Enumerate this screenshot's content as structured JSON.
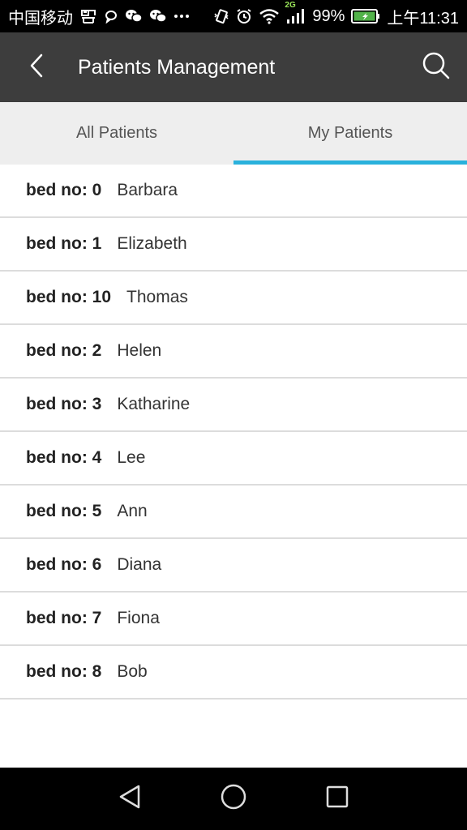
{
  "status_bar": {
    "carrier": "中国移动",
    "network_badge": "2G",
    "battery_percent": "99%",
    "time": "上午11:31",
    "left_icons": [
      "sim-icon",
      "chat-bubble-icon",
      "wechat-icon",
      "wechat-icon",
      "more-dots-icon"
    ],
    "right_icons": [
      "vibrate-icon",
      "alarm-icon",
      "wifi-icon",
      "signal-icon",
      "battery-icon"
    ]
  },
  "app_bar": {
    "title": "Patients Management",
    "back_icon": "back-arrow-icon",
    "search_icon": "search-icon",
    "background": "#3d3d3d"
  },
  "tabs": [
    {
      "label": "All Patients",
      "selected": false
    },
    {
      "label": "My Patients",
      "selected": true
    }
  ],
  "accent_color": "#2ab1dc",
  "patients": [
    {
      "bed": "bed no: 0",
      "name": "Barbara"
    },
    {
      "bed": "bed no: 1",
      "name": "Elizabeth"
    },
    {
      "bed": "bed no: 10",
      "name": "Thomas"
    },
    {
      "bed": "bed no: 2",
      "name": "Helen"
    },
    {
      "bed": "bed no: 3",
      "name": "Katharine"
    },
    {
      "bed": "bed no: 4",
      "name": "Lee"
    },
    {
      "bed": "bed no: 5",
      "name": "Ann"
    },
    {
      "bed": "bed no: 6",
      "name": "Diana"
    },
    {
      "bed": "bed no: 7",
      "name": "Fiona"
    },
    {
      "bed": "bed no: 8",
      "name": "Bob"
    }
  ],
  "nav_bar": {
    "buttons": [
      "back-triangle-icon",
      "home-circle-icon",
      "recents-square-icon"
    ]
  }
}
